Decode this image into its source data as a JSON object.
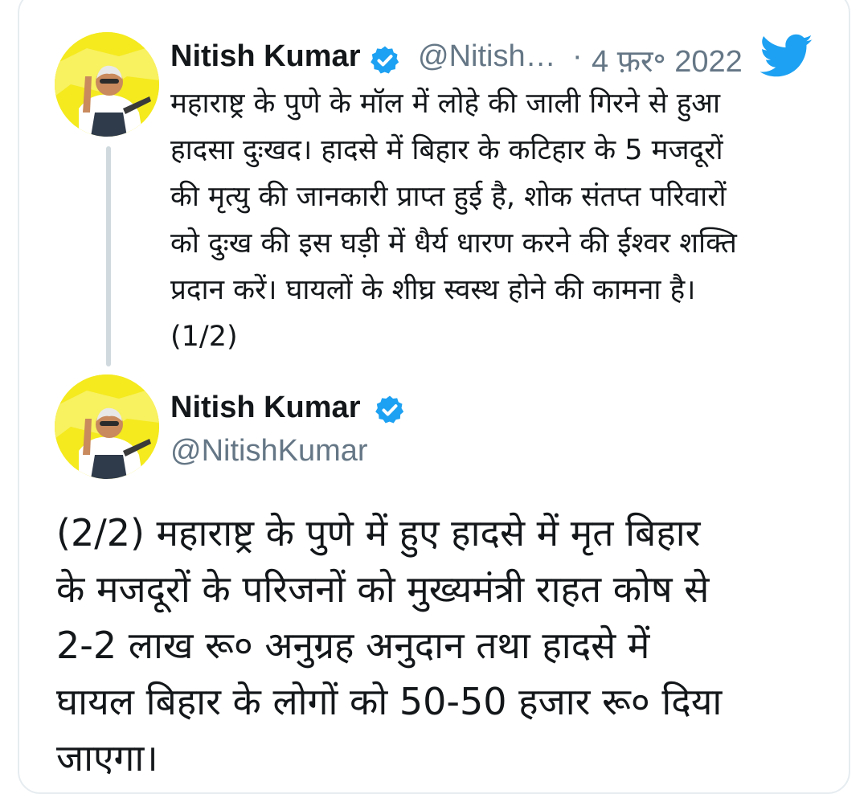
{
  "colors": {
    "twitter_blue": "#1da1f2",
    "text": "#14171a",
    "muted": "#657786",
    "avatar_bg": "#f4ea1e"
  },
  "tweet1": {
    "author_name": "Nitish Kumar",
    "handle": "@Nitish…",
    "separator": "·",
    "date": "4 फ़र॰ 2022",
    "lines": [
      "महाराष्ट्र के पुणे के मॉल में लोहे की जाली गिरने से हुआ",
      "हादसा दुःखद। हादसे में बिहार के कटिहार के 5 मजदूरों",
      "की मृत्यु की जानकारी प्राप्त हुई है, शोक संतप्त परिवारों",
      "को दुःख की इस घड़ी में धैर्य धारण करने की ईश्वर शक्ति",
      "प्रदान करें। घायलों के शीघ्र स्वस्थ होने की कामना है।",
      "(1/2)"
    ],
    "icons": [
      "avatar",
      "verified-badge-icon",
      "twitter-bird-icon"
    ]
  },
  "tweet2": {
    "author_name": "Nitish Kumar",
    "handle": "@NitishKumar",
    "lines": [
      "(2/2) महाराष्ट्र के पुणे में हुए हादसे में मृत बिहार",
      "के मजदूरों के परिजनों को मुख्यमंत्री राहत कोष से",
      "2-2 लाख रू० अनुग्रह अनुदान तथा हादसे में",
      "घायल बिहार के लोगों को 50-50 हजार रू० दिया",
      "जाएगा।"
    ],
    "icons": [
      "avatar",
      "verified-badge-icon"
    ]
  }
}
